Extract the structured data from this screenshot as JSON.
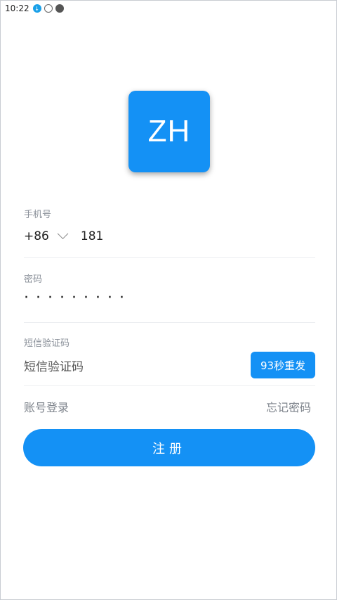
{
  "status_bar": {
    "time": "10:22",
    "icons": [
      "download-badge-icon",
      "shield-icon",
      "cat-icon"
    ]
  },
  "logo": {
    "text": "ZH"
  },
  "phone": {
    "label": "手机号",
    "country_code": "+86",
    "value": "181"
  },
  "password": {
    "label": "密码",
    "masked_value": "·········"
  },
  "sms": {
    "label": "短信验证码",
    "placeholder": "短信验证码",
    "resend_label": "93秒重发"
  },
  "links": {
    "account_login": "账号登录",
    "forgot_password": "忘记密码"
  },
  "register_button": "注册",
  "colors": {
    "accent": "#1491f5",
    "label_grey": "#8a9099",
    "divider": "#eceef1"
  }
}
